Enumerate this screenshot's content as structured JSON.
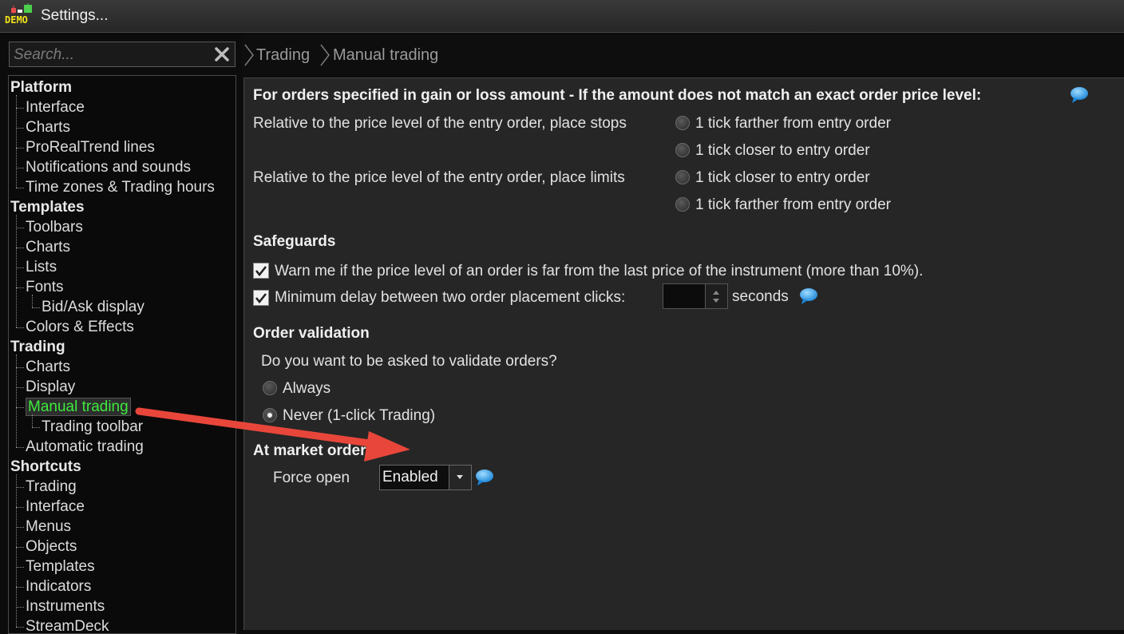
{
  "window": {
    "badge": "DEMO",
    "title": "Settings..."
  },
  "search": {
    "placeholder": "Search..."
  },
  "breadcrumb": [
    "Trading",
    "Manual trading"
  ],
  "tree": [
    {
      "label": "Platform",
      "kind": "cat",
      "level": 0
    },
    {
      "label": "Interface",
      "kind": "item",
      "level": 1
    },
    {
      "label": "Charts",
      "kind": "item",
      "level": 1
    },
    {
      "label": "ProRealTrend lines",
      "kind": "item",
      "level": 1
    },
    {
      "label": "Notifications and sounds",
      "kind": "item",
      "level": 1
    },
    {
      "label": "Time zones & Trading hours",
      "kind": "item",
      "level": 1
    },
    {
      "label": "Templates",
      "kind": "cat",
      "level": 0
    },
    {
      "label": "Toolbars",
      "kind": "item",
      "level": 1
    },
    {
      "label": "Charts",
      "kind": "item",
      "level": 1
    },
    {
      "label": "Lists",
      "kind": "item",
      "level": 1
    },
    {
      "label": "Fonts",
      "kind": "item",
      "level": 1
    },
    {
      "label": "Bid/Ask display",
      "kind": "item",
      "level": 2
    },
    {
      "label": "Colors & Effects",
      "kind": "item",
      "level": 1
    },
    {
      "label": "Trading",
      "kind": "cat",
      "level": 0
    },
    {
      "label": "Charts",
      "kind": "item",
      "level": 1
    },
    {
      "label": "Display",
      "kind": "item",
      "level": 1
    },
    {
      "label": "Manual trading",
      "kind": "item",
      "level": 1,
      "selected": true
    },
    {
      "label": "Trading toolbar",
      "kind": "item",
      "level": 2
    },
    {
      "label": "Automatic trading",
      "kind": "item",
      "level": 1
    },
    {
      "label": "Shortcuts",
      "kind": "cat",
      "level": 0
    },
    {
      "label": "Trading",
      "kind": "item",
      "level": 1
    },
    {
      "label": "Interface",
      "kind": "item",
      "level": 1
    },
    {
      "label": "Menus",
      "kind": "item",
      "level": 1
    },
    {
      "label": "Objects",
      "kind": "item",
      "level": 1
    },
    {
      "label": "Templates",
      "kind": "item",
      "level": 1
    },
    {
      "label": "Indicators",
      "kind": "item",
      "level": 1
    },
    {
      "label": "Instruments",
      "kind": "item",
      "level": 1
    },
    {
      "label": "StreamDeck",
      "kind": "item",
      "level": 1
    }
  ],
  "content": {
    "gain_loss": {
      "heading": "For orders specified in gain or loss amount - If the amount does not match an exact order price level:",
      "stops_label": "Relative to the price level of the entry order, place stops",
      "stops_options": [
        {
          "label": "1 tick farther from entry order",
          "selected": false
        },
        {
          "label": "1 tick closer to entry order",
          "selected": false
        }
      ],
      "limits_label": "Relative to the price level of the entry order, place limits",
      "limits_options": [
        {
          "label": "1 tick closer to entry order",
          "selected": false
        },
        {
          "label": "1 tick farther from entry order",
          "selected": false
        }
      ]
    },
    "safeguards": {
      "heading": "Safeguards",
      "warn_label": "Warn me if the price level of an order is far from the last price of the instrument (more than 10%).",
      "warn_checked": true,
      "delay_label": "Minimum delay between two order placement clicks:",
      "delay_checked": true,
      "delay_value": "",
      "delay_unit": "seconds"
    },
    "validation": {
      "heading": "Order validation",
      "question": "Do you want to be asked to validate orders?",
      "options": [
        {
          "label": "Always",
          "selected": false
        },
        {
          "label": "Never (1-click Trading)",
          "selected": true
        }
      ]
    },
    "market_order": {
      "heading": "At market order",
      "force_open_label": "Force open",
      "force_open_value": "Enabled"
    }
  },
  "colors": {
    "selected_text": "#3dea3d",
    "accent_arrow": "#e8463a",
    "info_bubble": "#3aa6f0"
  }
}
